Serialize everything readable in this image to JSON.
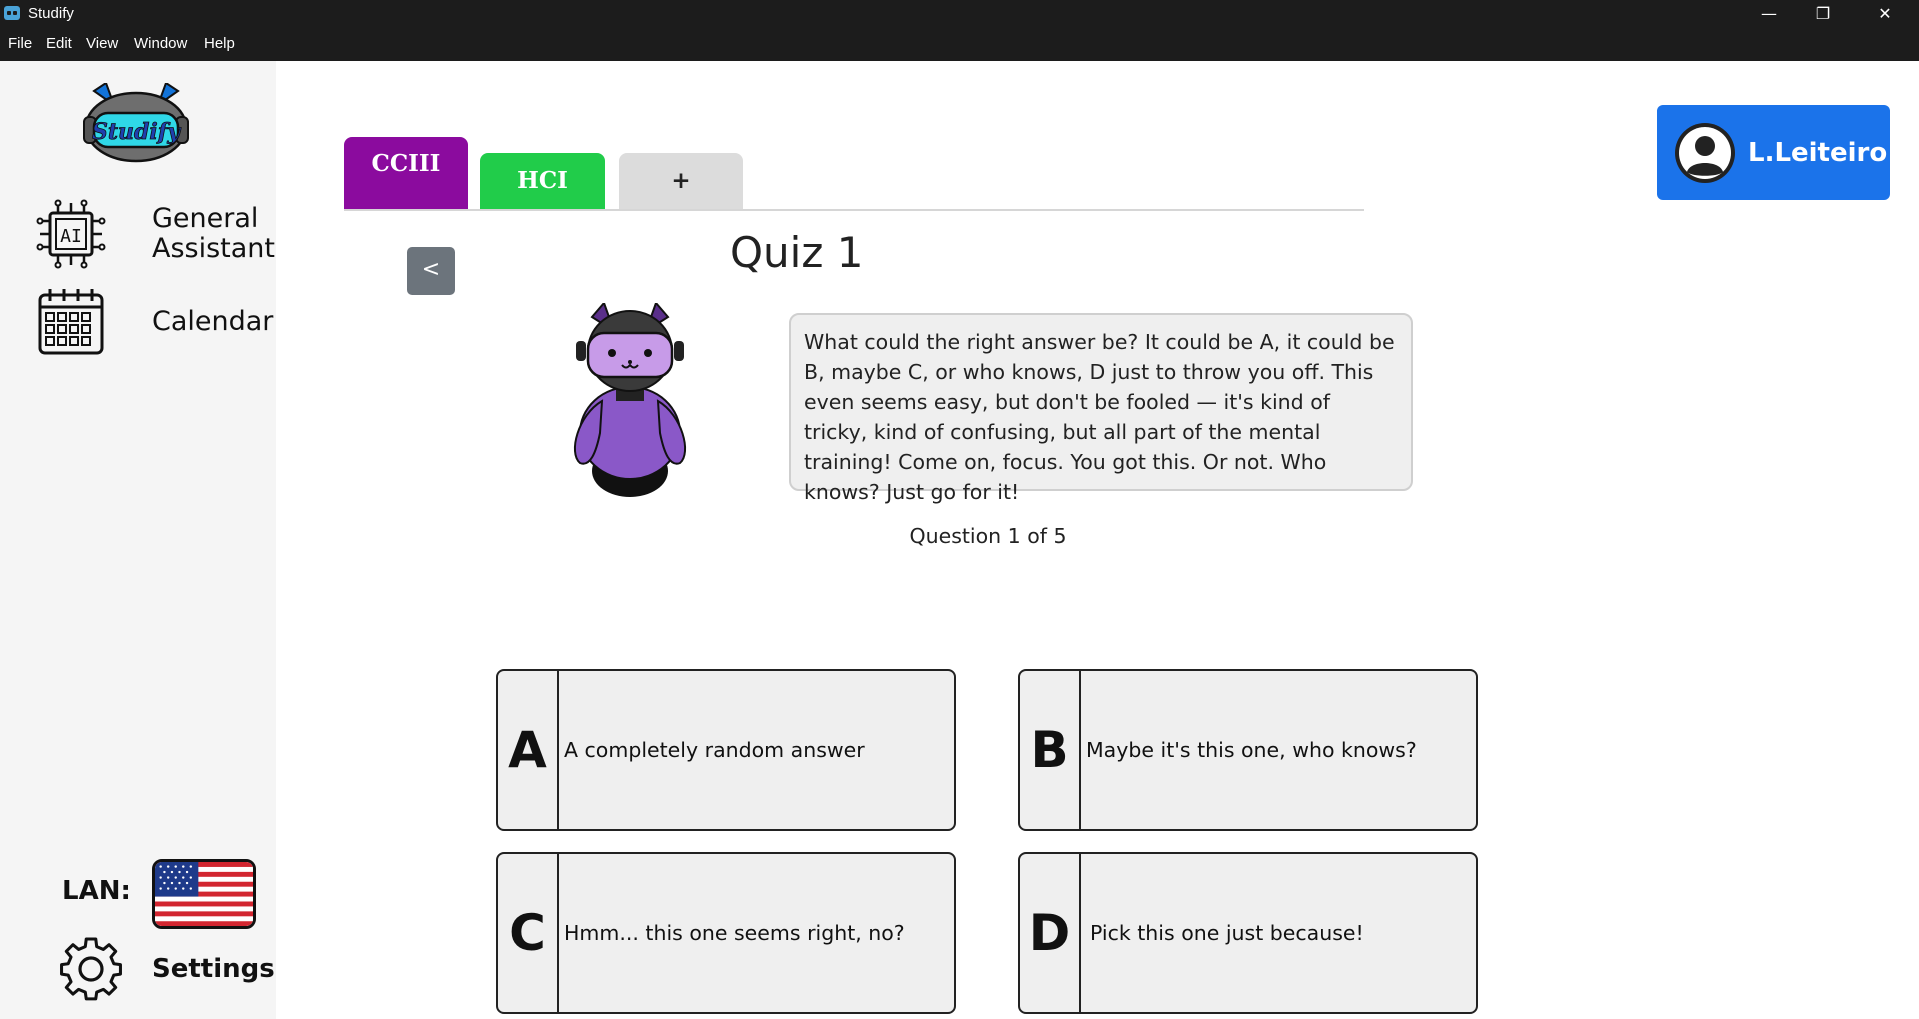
{
  "window": {
    "title": "Studify",
    "controls": {
      "minimize": "—",
      "maximize": "❐",
      "close": "✕"
    }
  },
  "menu": [
    "File",
    "Edit",
    "View",
    "Window",
    "Help"
  ],
  "sidebar": {
    "logo_text": "Studify",
    "items": [
      {
        "label_line1": "General",
        "label_line2": "Assistant",
        "icon": "ai-chip-icon",
        "icon_text": "AI"
      },
      {
        "label": "Calendar",
        "icon": "calendar-icon"
      }
    ],
    "language_label": "LAN:",
    "language_flag": "us-flag-icon",
    "settings_label": "Settings"
  },
  "tabs": [
    {
      "label": "CCIII",
      "color": "#8b0b9e",
      "active": true
    },
    {
      "label": "HCI",
      "color": "#21cc4a",
      "active": false
    },
    {
      "label": "+",
      "color": "#dcdcdc",
      "active": false
    }
  ],
  "user": {
    "name": "L.Leiteiro",
    "color": "#1b73ea"
  },
  "quiz": {
    "back_label": "<",
    "title": "Quiz 1",
    "question": "What could the right answer be? It could be A, it could be B, maybe C, or who knows, D just to throw you off. This even seems easy, but don't be fooled — it's kind of tricky, kind of confusing, but all part of the mental training! Come on, focus. You got this. Or not. Who knows? Just go for it!",
    "progress": "Question 1 of 5",
    "answers": [
      {
        "letter": "A",
        "text": "A completely random answer"
      },
      {
        "letter": "B",
        "text": "Maybe it's this one, who knows?"
      },
      {
        "letter": "C",
        "text": "Hmm... this one seems right, no?"
      },
      {
        "letter": "D",
        "text": "Pick this one just because!"
      }
    ]
  }
}
